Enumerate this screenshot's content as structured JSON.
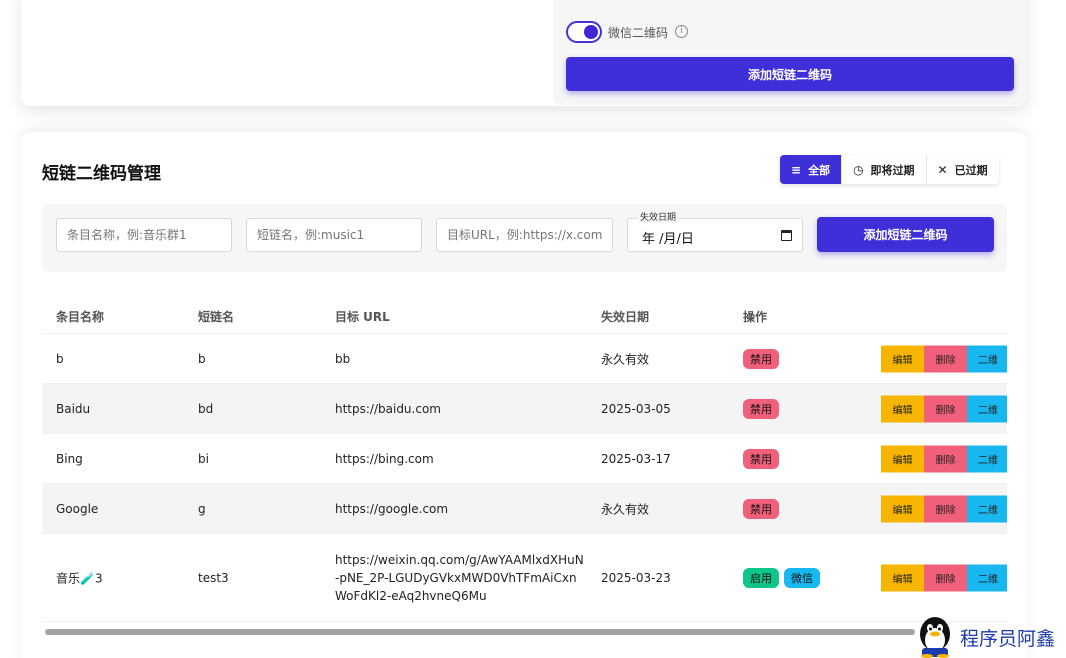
{
  "top": {
    "toggle_label": "微信二维码",
    "toggle_on": true,
    "add_button": "添加短链二维码"
  },
  "main": {
    "title": "短链二维码管理",
    "filters": [
      {
        "label": "全部",
        "icon": "list-icon",
        "active": true
      },
      {
        "label": "即将过期",
        "icon": "clock-icon",
        "active": false
      },
      {
        "label": "已过期",
        "icon": "close-icon",
        "active": false
      }
    ],
    "form": {
      "name_placeholder": "条目名称，例:音乐群1",
      "short_placeholder": "短链名，例:music1",
      "url_placeholder": "目标URL，例:https://x.com/",
      "date_legend": "失效日期",
      "date_value": "年 /月/日",
      "add_button": "添加短链二维码"
    },
    "table": {
      "headers": [
        "条目名称",
        "短链名",
        "目标 URL",
        "失效日期",
        "操作"
      ],
      "rows": [
        {
          "name": "b",
          "short": "b",
          "url": "bb",
          "expire": "永久有效",
          "status": "禁用",
          "wechat": ""
        },
        {
          "name": "Baidu",
          "short": "bd",
          "url": "https://baidu.com",
          "expire": "2025-03-05",
          "status": "禁用",
          "wechat": ""
        },
        {
          "name": "Bing",
          "short": "bi",
          "url": "https://bing.com",
          "expire": "2025-03-17",
          "status": "禁用",
          "wechat": ""
        },
        {
          "name": "Google",
          "short": "g",
          "url": "https://google.com",
          "expire": "永久有效",
          "status": "禁用",
          "wechat": ""
        },
        {
          "name": "音乐🧪3",
          "short": "test3",
          "url": "https://weixin.qq.com/g/AwYAAMlxdXHuN-pNE_2P-LGUDyGVkxMWD0VhTFmAiCxnWoFdKl2-eAq2hvneQ6Mu",
          "expire": "2025-03-23",
          "status": "启用",
          "wechat": "微信"
        }
      ],
      "row_actions": {
        "edit": "编辑",
        "delete": "删除",
        "qr": "二维"
      }
    }
  },
  "watermark": {
    "text": "程序员阿鑫",
    "icon": "penguin-icon"
  },
  "colors": {
    "primary": "#3f2fd8",
    "edit": "#f7b500",
    "delete": "#f1607a",
    "qr": "#18b7f0",
    "enable": "#10c58a"
  }
}
